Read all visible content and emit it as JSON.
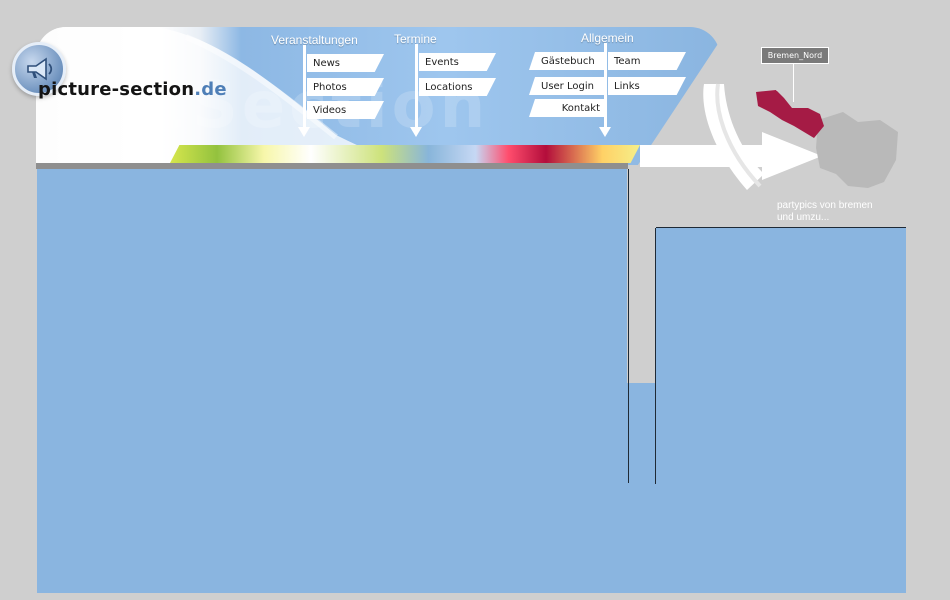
{
  "logo": {
    "text": "picture-section",
    "tld": ".de",
    "icon": "megaphone-icon",
    "watermark": "picSection"
  },
  "nav": {
    "groups": [
      {
        "title": "Veranstaltungen",
        "items": [
          "News",
          "Photos",
          "Videos"
        ]
      },
      {
        "title": "Termine",
        "items": [
          "Events",
          "Locations"
        ]
      },
      {
        "title": "Allgemein",
        "items": [
          "Gästebuch",
          "Team",
          "User Login",
          "Links",
          "Kontakt"
        ]
      }
    ]
  },
  "map": {
    "region_label": "Bremen_Nord",
    "caption": "partypics von bremen und umzu..."
  },
  "colors": {
    "page_bg": "#cfcfcf",
    "panel": "#8ab5e0",
    "header_blue": "#9ec6ee",
    "map_highlight": "#a51b45",
    "map_gray": "#b9b9b9"
  }
}
